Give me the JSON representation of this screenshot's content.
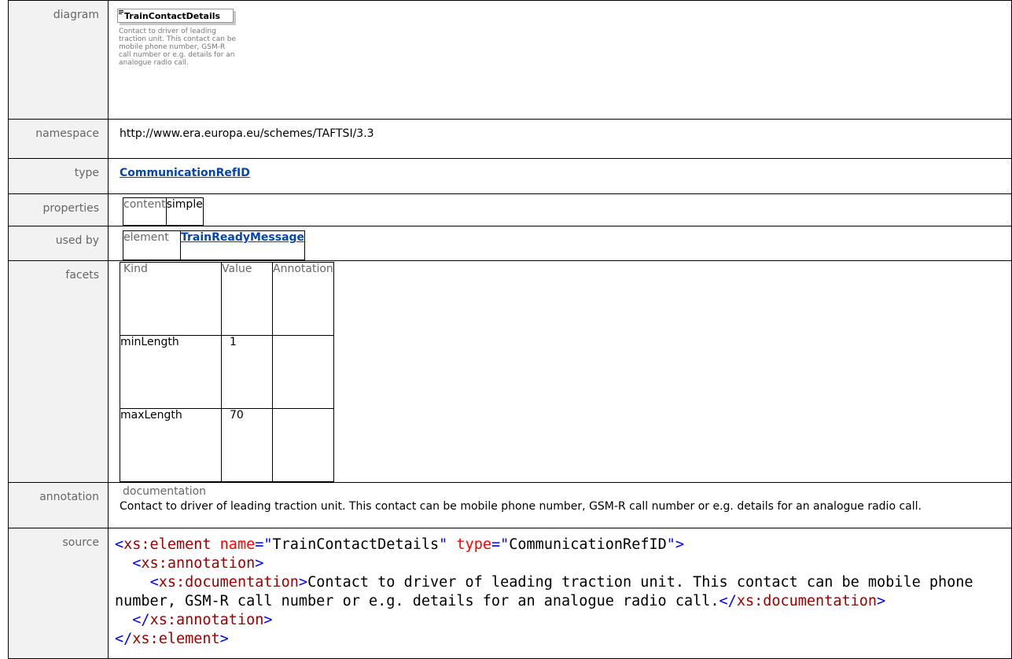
{
  "labels": {
    "diagram": "diagram",
    "namespace": "namespace",
    "type": "type",
    "properties": "properties",
    "used_by": "used by",
    "facets": "facets",
    "annotation": "annotation",
    "source": "source"
  },
  "diagram": {
    "element_name": "TrainContactDetails",
    "doc": "Contact to driver of leading traction unit. This contact can be mobile phone number, GSM-R call number or e.g. details for an analogue radio call."
  },
  "namespace": "http://www.era.europa.eu/schemes/TAFTSI/3.3",
  "type": "CommunicationRefID",
  "properties": {
    "key": "content",
    "value": "simple"
  },
  "used_by": {
    "kind": "element",
    "link": "TrainReadyMessage"
  },
  "facets": {
    "headers": [
      "Kind",
      "Value",
      "Annotation"
    ],
    "rows": [
      {
        "kind": "minLength",
        "value": "1",
        "annotation": ""
      },
      {
        "kind": "maxLength",
        "value": "70",
        "annotation": ""
      }
    ]
  },
  "annotation": {
    "heading": "documentation",
    "text": "Contact to driver of leading traction unit. This contact can be mobile phone number, GSM-R call number or e.g. details for an analogue radio call."
  },
  "source": {
    "lines": [
      {
        "parts": [
          [
            "tag",
            "<"
          ],
          [
            "nm",
            "xs:element"
          ],
          [
            "sp",
            " "
          ],
          [
            "att",
            "name"
          ],
          [
            "q",
            "=\""
          ],
          [
            "av",
            "TrainContactDetails"
          ],
          [
            "q",
            "\""
          ],
          [
            "sp",
            " "
          ],
          [
            "att",
            "type"
          ],
          [
            "q",
            "=\""
          ],
          [
            "av",
            "CommunicationRefID"
          ],
          [
            "q",
            "\""
          ],
          [
            "tag",
            ">"
          ]
        ]
      },
      {
        "parts": [
          [
            "sp",
            "  "
          ],
          [
            "tag",
            "<"
          ],
          [
            "nm",
            "xs:annotation"
          ],
          [
            "tag",
            ">"
          ]
        ]
      },
      {
        "parts": [
          [
            "sp",
            "    "
          ],
          [
            "tag",
            "<"
          ],
          [
            "nm",
            "xs:documentation"
          ],
          [
            "tag",
            ">"
          ],
          [
            "txt",
            "Contact to driver of leading traction unit. This contact can be mobile phone number, GSM-R call number or e.g. details for an analogue radio call."
          ],
          [
            "tag",
            "</"
          ],
          [
            "nm",
            "xs:documentation"
          ],
          [
            "tag",
            ">"
          ]
        ]
      },
      {
        "parts": [
          [
            "sp",
            "  "
          ],
          [
            "tag",
            "</"
          ],
          [
            "nm",
            "xs:annotation"
          ],
          [
            "tag",
            ">"
          ]
        ]
      },
      {
        "parts": [
          [
            "tag",
            "</"
          ],
          [
            "nm",
            "xs:element"
          ],
          [
            "tag",
            ">"
          ]
        ]
      }
    ]
  }
}
